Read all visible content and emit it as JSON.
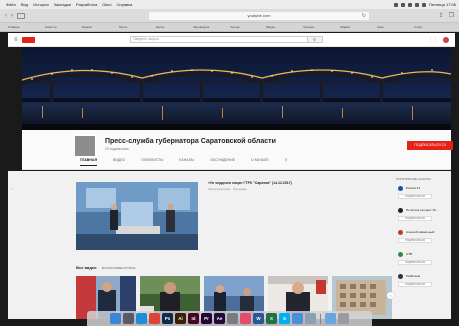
{
  "os_menu": {
    "apple": "",
    "items": [
      "Файл",
      "Вид",
      "История",
      "Закладки",
      "Разработка",
      "Окно",
      "Справка"
    ],
    "right_clock": "Пятница 17:06"
  },
  "browser": {
    "url": "youtube.com",
    "bookmarks": [
      "Главная",
      "Новости",
      "Яндекс",
      "Почта",
      "Карты",
      "Переводчик",
      "Погода",
      "Видео",
      "Музыка",
      "Маркет",
      "Кино",
      "Спорт"
    ]
  },
  "yt_header": {
    "search_placeholder": "Введите запрос",
    "search_icon": "search-icon"
  },
  "channel": {
    "name": "Пресс-служба губернатора Саратовской области",
    "subscribers": "23 подписчика",
    "subscribe_label": "ПОДПИСАТЬСЯ 23",
    "tabs": [
      {
        "label": "ГЛАВНАЯ",
        "active": true
      },
      {
        "label": "ВИДЕО",
        "active": false
      },
      {
        "label": "ПЛЕЙЛИСТЫ",
        "active": false
      },
      {
        "label": "КАНАЛЫ",
        "active": false
      },
      {
        "label": "ОБСУЖДЕНИЕ",
        "active": false
      },
      {
        "label": "О КАНАЛЕ",
        "active": false
      }
    ]
  },
  "featured": {
    "title": "«Ул чердного лица» ГТРК \"Саратов\" (14.12.2017)",
    "meta": "116 просмотров · Год назад"
  },
  "videos_section": {
    "title": "Все видео",
    "play_all": "ВОСПРОИЗВЕСТИ ВСЕ"
  },
  "sidebar": {
    "title": "ПОПУЛЯРНЫЕ КАНАЛЫ",
    "channels": [
      {
        "name": "Россия 24",
        "color": "#1b4fa3",
        "button": "ПОДПИСАТЬСЯ"
      },
      {
        "name": "Политика сегодня: Ро...",
        "color": "#222222",
        "button": "ПОДПИСАТЬСЯ"
      },
      {
        "name": "Алексей Навальный",
        "color": "#c0392b",
        "button": "ПОДПИСАТЬСЯ"
      },
      {
        "name": "ОТВ",
        "color": "#2e8b3e",
        "button": "ПОДПИСАТЬСЯ"
      },
      {
        "name": "PoliRussia",
        "color": "#333333",
        "button": "ПОДПИСАТЬСЯ"
      }
    ]
  },
  "dock": {
    "apps": [
      {
        "icon": "finder-icon",
        "label": "",
        "color": "#3a86d6"
      },
      {
        "icon": "launchpad-icon",
        "label": "",
        "color": "#5a5a66"
      },
      {
        "icon": "safari-icon",
        "label": "",
        "color": "#1a8fd8"
      },
      {
        "icon": "chrome-icon",
        "label": "",
        "color": "#db4437"
      },
      {
        "icon": "photoshop-icon",
        "label": "Ps",
        "color": "#0f2a4a"
      },
      {
        "icon": "illustrator-icon",
        "label": "Ai",
        "color": "#3a1e06"
      },
      {
        "icon": "indesign-icon",
        "label": "Id",
        "color": "#49021f"
      },
      {
        "icon": "premiere-icon",
        "label": "Pr",
        "color": "#22062f"
      },
      {
        "icon": "aftereffects-icon",
        "label": "Ae",
        "color": "#1f0a3a"
      },
      {
        "icon": "settings-icon",
        "label": "",
        "color": "#7b7b80"
      },
      {
        "icon": "itunes-icon",
        "label": "",
        "color": "#e24c6e"
      },
      {
        "icon": "word-icon",
        "label": "W",
        "color": "#2b579a"
      },
      {
        "icon": "excel-icon",
        "label": "X",
        "color": "#217346"
      },
      {
        "icon": "skype-icon",
        "label": "S",
        "color": "#00aff0"
      },
      {
        "icon": "mail-icon",
        "label": "",
        "color": "#4a90d9"
      },
      {
        "icon": "preview-icon",
        "label": "",
        "color": "#8aa0b5"
      },
      {
        "icon": "folder-icon",
        "label": "",
        "color": "#6aa5e0"
      },
      {
        "icon": "trash-icon",
        "label": "",
        "color": "#9a9aa0"
      }
    ]
  }
}
